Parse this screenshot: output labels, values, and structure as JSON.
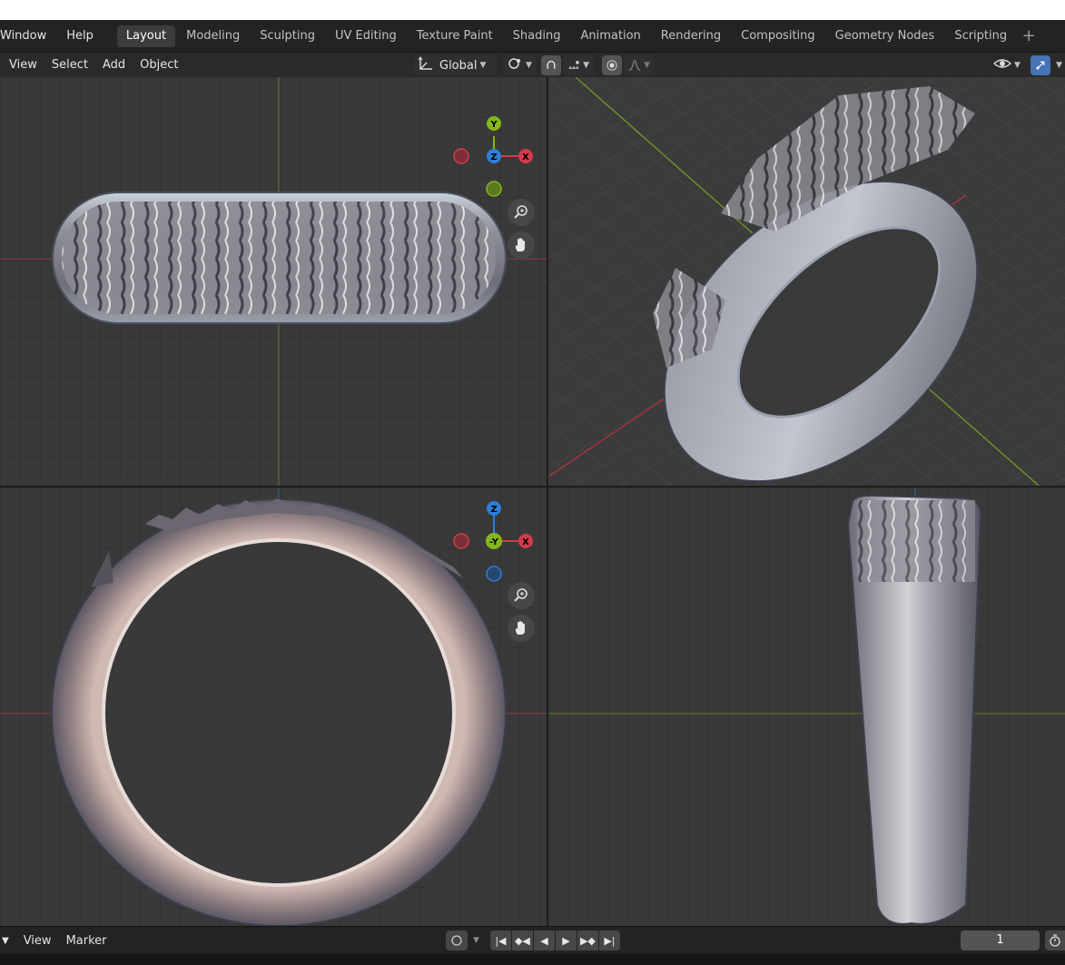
{
  "topbar": {
    "menus": [
      "Window",
      "Help"
    ],
    "tabs": [
      {
        "label": "Layout",
        "active": true
      },
      {
        "label": "Modeling"
      },
      {
        "label": "Sculpting"
      },
      {
        "label": "UV Editing"
      },
      {
        "label": "Texture Paint"
      },
      {
        "label": "Shading"
      },
      {
        "label": "Animation"
      },
      {
        "label": "Rendering"
      },
      {
        "label": "Compositing"
      },
      {
        "label": "Geometry Nodes"
      },
      {
        "label": "Scripting"
      }
    ],
    "add_tab_icon": "plus-icon"
  },
  "viewport_header": {
    "menus": [
      "View",
      "Select",
      "Add",
      "Object"
    ],
    "transform_orientation": "Global",
    "icons": [
      "transform-orientation-icon",
      "pivot-icon",
      "snap-icon",
      "snap-increment-icon",
      "proportional-edit-icon",
      "falloff-icon",
      "visibility-icon",
      "gizmo-toggle-icon"
    ]
  },
  "gizmo": {
    "top_view": {
      "x": "X",
      "y": "Y",
      "z": "Z"
    },
    "front_view": {
      "x": "X",
      "y": "-Y",
      "z": "Z"
    },
    "colors": {
      "x": "#d33c4c",
      "y": "#86b61b",
      "z": "#2f7ed7"
    }
  },
  "timeline": {
    "menus": [
      "View",
      "Marker"
    ],
    "current_frame": "1",
    "icons": [
      "keyframe-icon",
      "jump-start-icon",
      "prev-keyframe-icon",
      "play-reverse-icon",
      "play-icon",
      "next-keyframe-icon",
      "jump-end-icon",
      "stopwatch-icon"
    ]
  },
  "colors": {
    "accent": "#4772b3",
    "background": "#1d1d1d",
    "grid": "#393939"
  }
}
